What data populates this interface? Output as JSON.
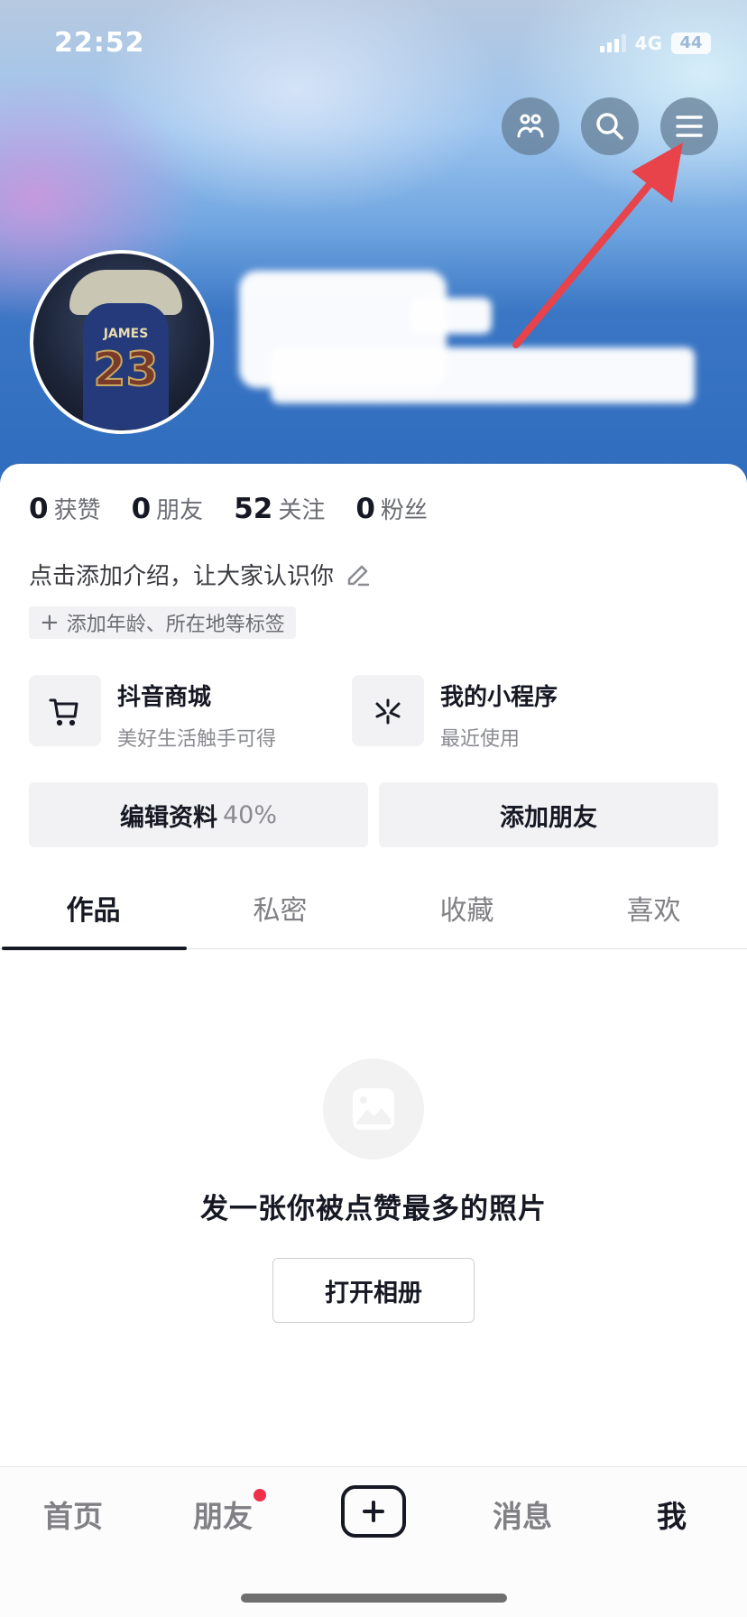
{
  "status_bar": {
    "time": "22:52",
    "network": "4G",
    "battery": "44"
  },
  "header": {
    "icons": [
      "friends-icon",
      "search-icon",
      "menu-icon"
    ],
    "avatar_jersey_name": "JAMES",
    "avatar_jersey_number": "23",
    "username": "",
    "annotation_arrow_color": "#e8434a"
  },
  "stats": [
    {
      "value": "0",
      "label": "获赞"
    },
    {
      "value": "0",
      "label": "朋友"
    },
    {
      "value": "52",
      "label": "关注"
    },
    {
      "value": "0",
      "label": "粉丝"
    }
  ],
  "bio": {
    "placeholder": "点击添加介绍，让大家认识你"
  },
  "tag_chip": {
    "label": "添加年龄、所在地等标签"
  },
  "shortcuts": [
    {
      "title": "抖音商城",
      "subtitle": "美好生活触手可得",
      "icon": "cart-icon"
    },
    {
      "title": "我的小程序",
      "subtitle": "最近使用",
      "icon": "mini-program-icon"
    }
  ],
  "actions": {
    "edit_profile": "编辑资料",
    "edit_progress": "40%",
    "add_friends": "添加朋友"
  },
  "tabs": [
    {
      "label": "作品",
      "active": true
    },
    {
      "label": "私密",
      "active": false
    },
    {
      "label": "收藏",
      "active": false
    },
    {
      "label": "喜欢",
      "active": false
    }
  ],
  "empty_state": {
    "message": "发一张你被点赞最多的照片",
    "button": "打开相册"
  },
  "bottom_nav": [
    {
      "label": "首页",
      "active": false
    },
    {
      "label": "朋友",
      "active": false,
      "badge": true
    },
    {
      "label": "+",
      "type": "create"
    },
    {
      "label": "消息",
      "active": false
    },
    {
      "label": "我",
      "active": true
    }
  ],
  "colors": {
    "text_primary": "#161823",
    "text_secondary": "#6b6d73",
    "badge": "#f0304a",
    "header_blue": "#2f6bbd"
  }
}
